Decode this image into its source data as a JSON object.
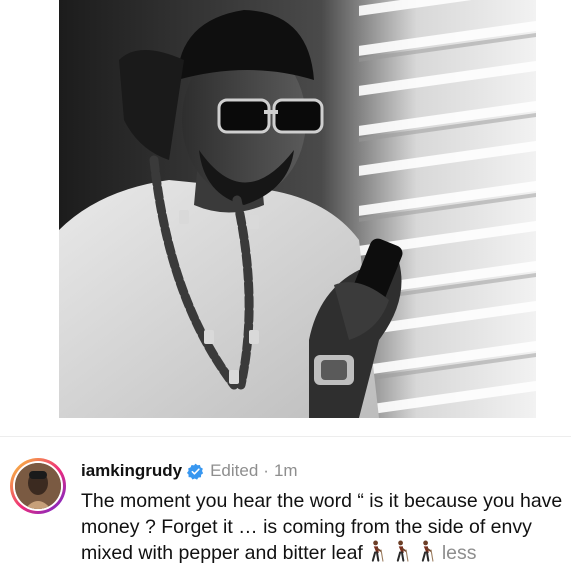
{
  "post": {
    "photo_alt": "",
    "username": "iamkingrudy",
    "verified": true,
    "edited_label": "Edited",
    "separator": "·",
    "time_ago": "1m",
    "caption_text": "The moment you hear the word “ is it because you have money ?  Forget it … is coming from the side of envy mixed with pepper and bitter leaf",
    "caption_emojis": [
      "person-walking-with-cane",
      "person-walking-with-cane",
      "person-walking-with-cane"
    ],
    "less_label": "less"
  },
  "colors": {
    "verified_badge": "#3897f0",
    "muted_text": "#8e8e8e",
    "primary_text": "#111111",
    "story_ring": [
      "#f9ce34",
      "#ee2a7b",
      "#6228d7"
    ]
  }
}
